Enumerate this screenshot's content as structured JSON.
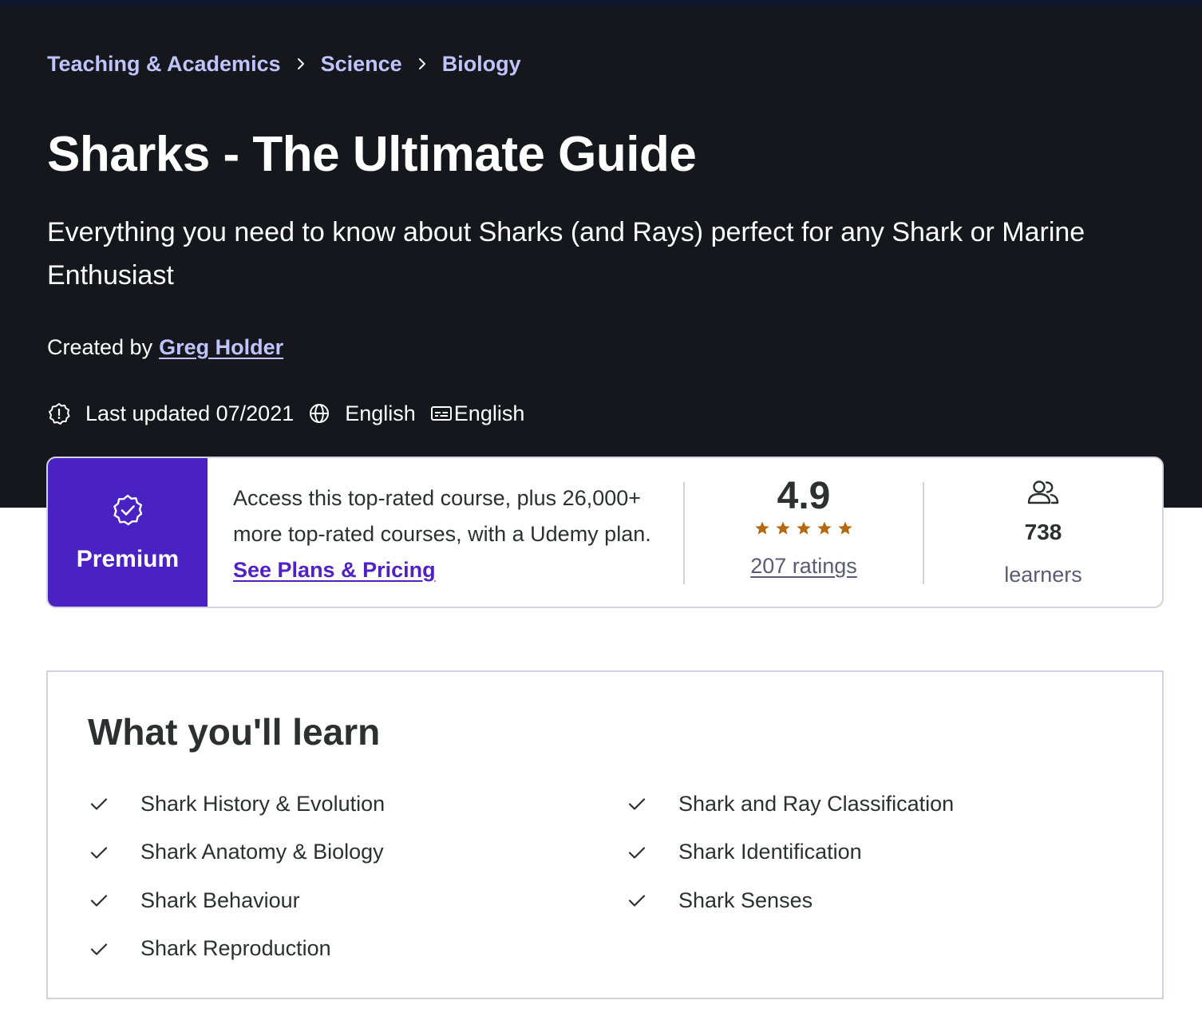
{
  "breadcrumb": [
    {
      "label": "Teaching & Academics"
    },
    {
      "label": "Science"
    },
    {
      "label": "Biology"
    }
  ],
  "course": {
    "title": "Sharks - The Ultimate Guide",
    "subtitle": "Everything you need to know about Sharks (and Rays) perfect for any Shark or Marine Enthusiast",
    "created_by_label": "Created by",
    "instructor": "Greg Holder",
    "last_updated": "Last updated 07/2021",
    "language": "English",
    "captions": "English"
  },
  "stats": {
    "premium_label": "Premium",
    "plan_text": "Access this top-rated course, plus 26,000+ more top-rated courses, with a Udemy plan.",
    "plan_link": "See Plans & Pricing",
    "rating": "4.9",
    "stars": 5,
    "ratings_count": "207 ratings",
    "learners_count": "738",
    "learners_label": "learners"
  },
  "learn": {
    "title": "What you'll learn",
    "left": [
      {
        "text": "Shark History & Evolution"
      },
      {
        "text": "Shark Anatomy & Biology"
      },
      {
        "text": "Shark Behaviour"
      },
      {
        "text": "Shark Reproduction"
      }
    ],
    "right": [
      {
        "text": "Shark and Ray Classification"
      },
      {
        "text": "Shark Identification"
      },
      {
        "text": "Shark Senses"
      }
    ]
  },
  "colors": {
    "hero_bg": "#16161d",
    "breadcrumb_link": "#c0c4fc",
    "premium_bg": "#4a22c4",
    "plan_link": "#5022c3",
    "star": "#b4690e",
    "border": "#d1d2e0"
  },
  "icons": {
    "breadcrumb_separator": "chevron-right-icon",
    "last_updated": "alert-badge-icon",
    "language": "globe-icon",
    "captions": "closed-captions-icon",
    "premium": "verified-badge-icon",
    "star": "star-icon",
    "learners": "users-icon",
    "learn_item": "check-icon"
  }
}
